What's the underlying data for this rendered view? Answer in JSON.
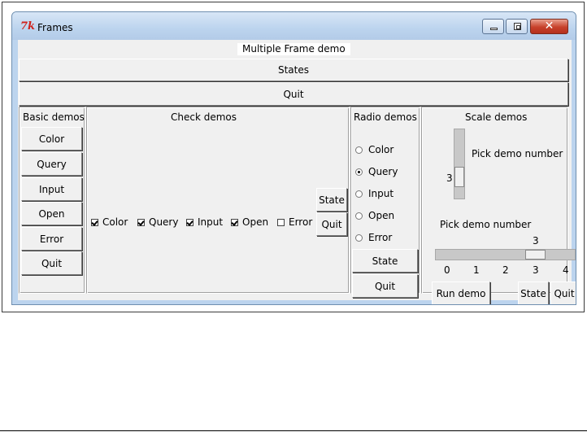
{
  "window": {
    "title": "Frames",
    "icon": "tk-feather-icon",
    "caption_buttons": {
      "minimize": "minimize-icon",
      "maximize": "maximize-icon",
      "close": "close-icon"
    }
  },
  "header": {
    "label": "Multiple Frame demo",
    "states_button": "States",
    "quit_button": "Quit"
  },
  "basic": {
    "title": "Basic demos",
    "buttons": [
      "Color",
      "Query",
      "Input",
      "Open",
      "Error",
      "Quit"
    ]
  },
  "check": {
    "title": "Check demos",
    "items": [
      {
        "label": "Color",
        "checked": true
      },
      {
        "label": "Query",
        "checked": true
      },
      {
        "label": "Input",
        "checked": true
      },
      {
        "label": "Open",
        "checked": true
      },
      {
        "label": "Error",
        "checked": false
      }
    ],
    "state_button": "State",
    "quit_button": "Quit"
  },
  "radio": {
    "title": "Radio demos",
    "items": [
      "Color",
      "Query",
      "Input",
      "Open",
      "Error"
    ],
    "selected": "Query",
    "state_button": "State",
    "quit_button": "Quit"
  },
  "scale": {
    "title": "Scale demos",
    "vertical_label": "Pick demo number",
    "vertical_value": "3",
    "horizontal_label": "Pick demo number",
    "horizontal_value": "3",
    "ticks": [
      "0",
      "1",
      "2",
      "3",
      "4"
    ],
    "run_button": "Run demo",
    "state_button": "State",
    "quit_button": "Quit"
  }
}
